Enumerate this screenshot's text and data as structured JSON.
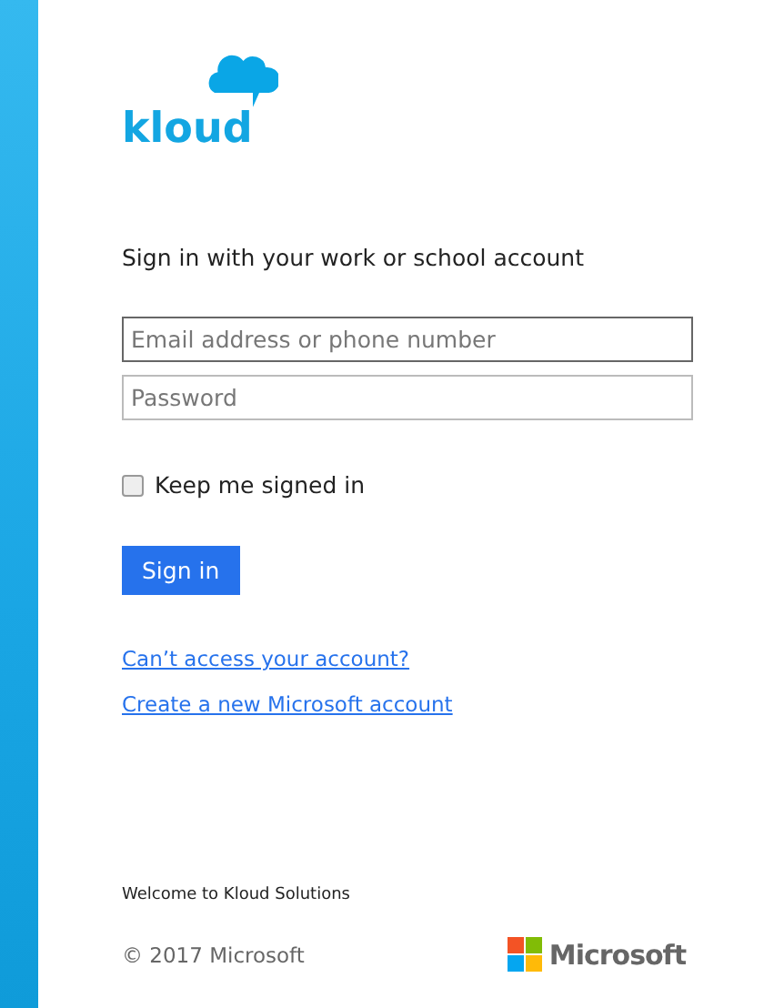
{
  "logo": {
    "text": "kloud"
  },
  "heading": "Sign in with your work or school account",
  "fields": [
    {
      "placeholder": "Email address or phone number",
      "focused": true
    },
    {
      "placeholder": "Password",
      "focused": false
    }
  ],
  "keep_signed_in": {
    "label": "Keep me signed in",
    "checked": false
  },
  "sign_in_button": "Sign in",
  "links": [
    "Can’t access your account?",
    "Create a new Microsoft account"
  ],
  "welcome": "Welcome to Kloud Solutions",
  "copyright": "© 2017 Microsoft",
  "brand": "Microsoft"
}
